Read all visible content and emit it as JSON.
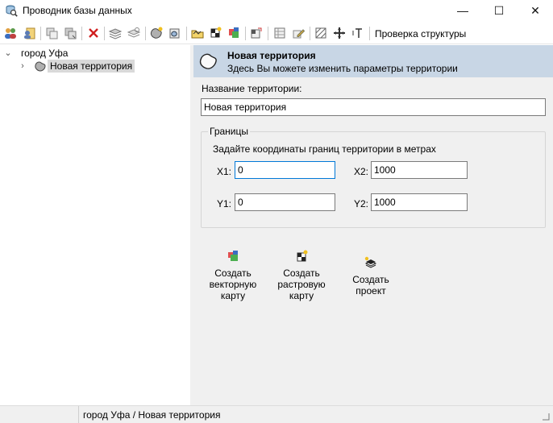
{
  "window": {
    "title": "Проводник базы данных",
    "minimize_glyph": "—",
    "maximize_glyph": "☐",
    "close_glyph": "✕"
  },
  "toolbar": {
    "check_structure_label": "Проверка структуры",
    "icons": [
      "users-icon",
      "user-card-icon",
      "copy-icon",
      "paste-icon",
      "delete-icon",
      "layers-icon",
      "layers-edit-icon",
      "territory-icon",
      "territory-edit-icon",
      "folder-open-icon",
      "raster-icon",
      "vector-icon",
      "export-icon",
      "table-icon",
      "pencil-icon",
      "hatch-icon",
      "crosshair-icon",
      "text-tool-icon"
    ]
  },
  "tree": {
    "root_label": "город Уфа",
    "child_label": "Новая территория"
  },
  "panel": {
    "banner_title": "Новая территория",
    "banner_subtitle": "Здесь Вы можете изменить параметры территории",
    "name_label": "Название территории:",
    "name_value": "Новая территория",
    "bounds_legend": "Границы",
    "bounds_hint": "Задайте координаты границ территории в метрах",
    "x1_label": "X1:",
    "x1_value": "0",
    "x2_label": "X2:",
    "x2_value": "1000",
    "y1_label": "Y1:",
    "y1_value": "0",
    "y2_label": "Y2:",
    "y2_value": "1000"
  },
  "actions": [
    {
      "line1": "Создать",
      "line2": "векторную",
      "line3": "карту"
    },
    {
      "line1": "Создать",
      "line2": "растровую",
      "line3": "карту"
    },
    {
      "line1": "Создать",
      "line2": "проект"
    }
  ],
  "status": {
    "path": "город Уфа / Новая территория"
  },
  "colors": {
    "banner_bg": "#c8d6e5",
    "panel_bg": "#f0f0f0",
    "focus_border": "#0078d7"
  }
}
